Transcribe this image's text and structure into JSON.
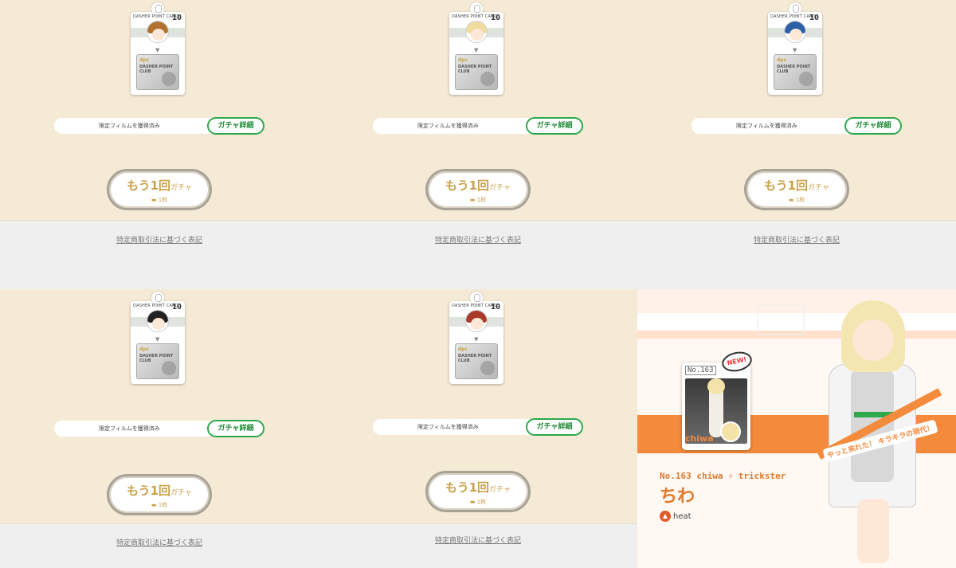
{
  "card": {
    "header": "DASHER POINT CARD",
    "count": "10",
    "logo": "dpc",
    "club_text": "DASHER POINT CLUB"
  },
  "status_label": "限定フィルムを獲得済み",
  "gacha_detail": "ガチャ詳細",
  "again": {
    "main": "もう1回",
    "sub": "ガチャ",
    "cost": "1枚"
  },
  "legal_link": "特定商取引法に基づく表記",
  "panels": [
    {
      "hair_color": "#b0722f"
    },
    {
      "hair_color": "#f1dca0"
    },
    {
      "hair_color": "#2b5fa8"
    },
    {
      "hair_color": "#222222"
    },
    {
      "hair_color": "#a83a2b"
    }
  ],
  "character": {
    "number": "No.163",
    "new_tag": "NEW!",
    "card_name": "chiwa",
    "info_line_no": "No.163 chiwa",
    "info_line_type": "trickster",
    "japanese_name": "ちわ",
    "element": "heat",
    "speech": "やっと来れた！ キラキラの現代！"
  },
  "colors": {
    "cream": "#f5ead6",
    "green": "#2da84b",
    "gold": "#c8a24a",
    "orange": "#f48a3c"
  }
}
